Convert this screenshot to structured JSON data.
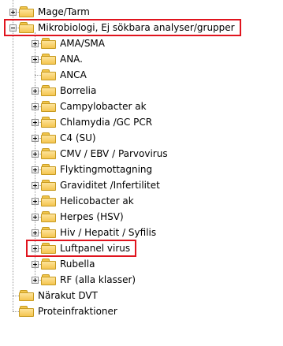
{
  "tree": {
    "root_nodes": [
      {
        "label": "Mage/Tarm",
        "expander": "plus"
      },
      {
        "label": "Mikrobiologi, Ej sökbara analyser/grupper",
        "expander": "minus",
        "highlighted": true
      },
      {
        "label": "Närakut DVT",
        "expander": "none"
      },
      {
        "label": "Proteinfraktioner",
        "expander": "none"
      }
    ],
    "child_nodes": [
      {
        "label": "AMA/SMA",
        "expander": "plus"
      },
      {
        "label": "ANA.",
        "expander": "plus"
      },
      {
        "label": "ANCA",
        "expander": "none"
      },
      {
        "label": "Borrelia",
        "expander": "plus"
      },
      {
        "label": "Campylobacter ak",
        "expander": "plus"
      },
      {
        "label": "Chlamydia /GC PCR",
        "expander": "plus"
      },
      {
        "label": "C4 (SU)",
        "expander": "plus"
      },
      {
        "label": "CMV / EBV / Parvovirus",
        "expander": "plus"
      },
      {
        "label": "Flyktingmottagning",
        "expander": "plus"
      },
      {
        "label": "Graviditet /Infertilitet",
        "expander": "plus"
      },
      {
        "label": "Helicobacter ak",
        "expander": "plus"
      },
      {
        "label": "Herpes (HSV)",
        "expander": "plus"
      },
      {
        "label": "Hiv / Hepatit / Syfilis",
        "expander": "plus"
      },
      {
        "label": "Luftpanel virus",
        "expander": "plus",
        "highlighted": true
      },
      {
        "label": "Rubella",
        "expander": "plus"
      },
      {
        "label": "RF (alla klasser)",
        "expander": "plus"
      }
    ]
  },
  "colors": {
    "highlight_border": "#e0141e",
    "folder_fill": "#f5c550",
    "connector_line": "#9a9a9a"
  }
}
